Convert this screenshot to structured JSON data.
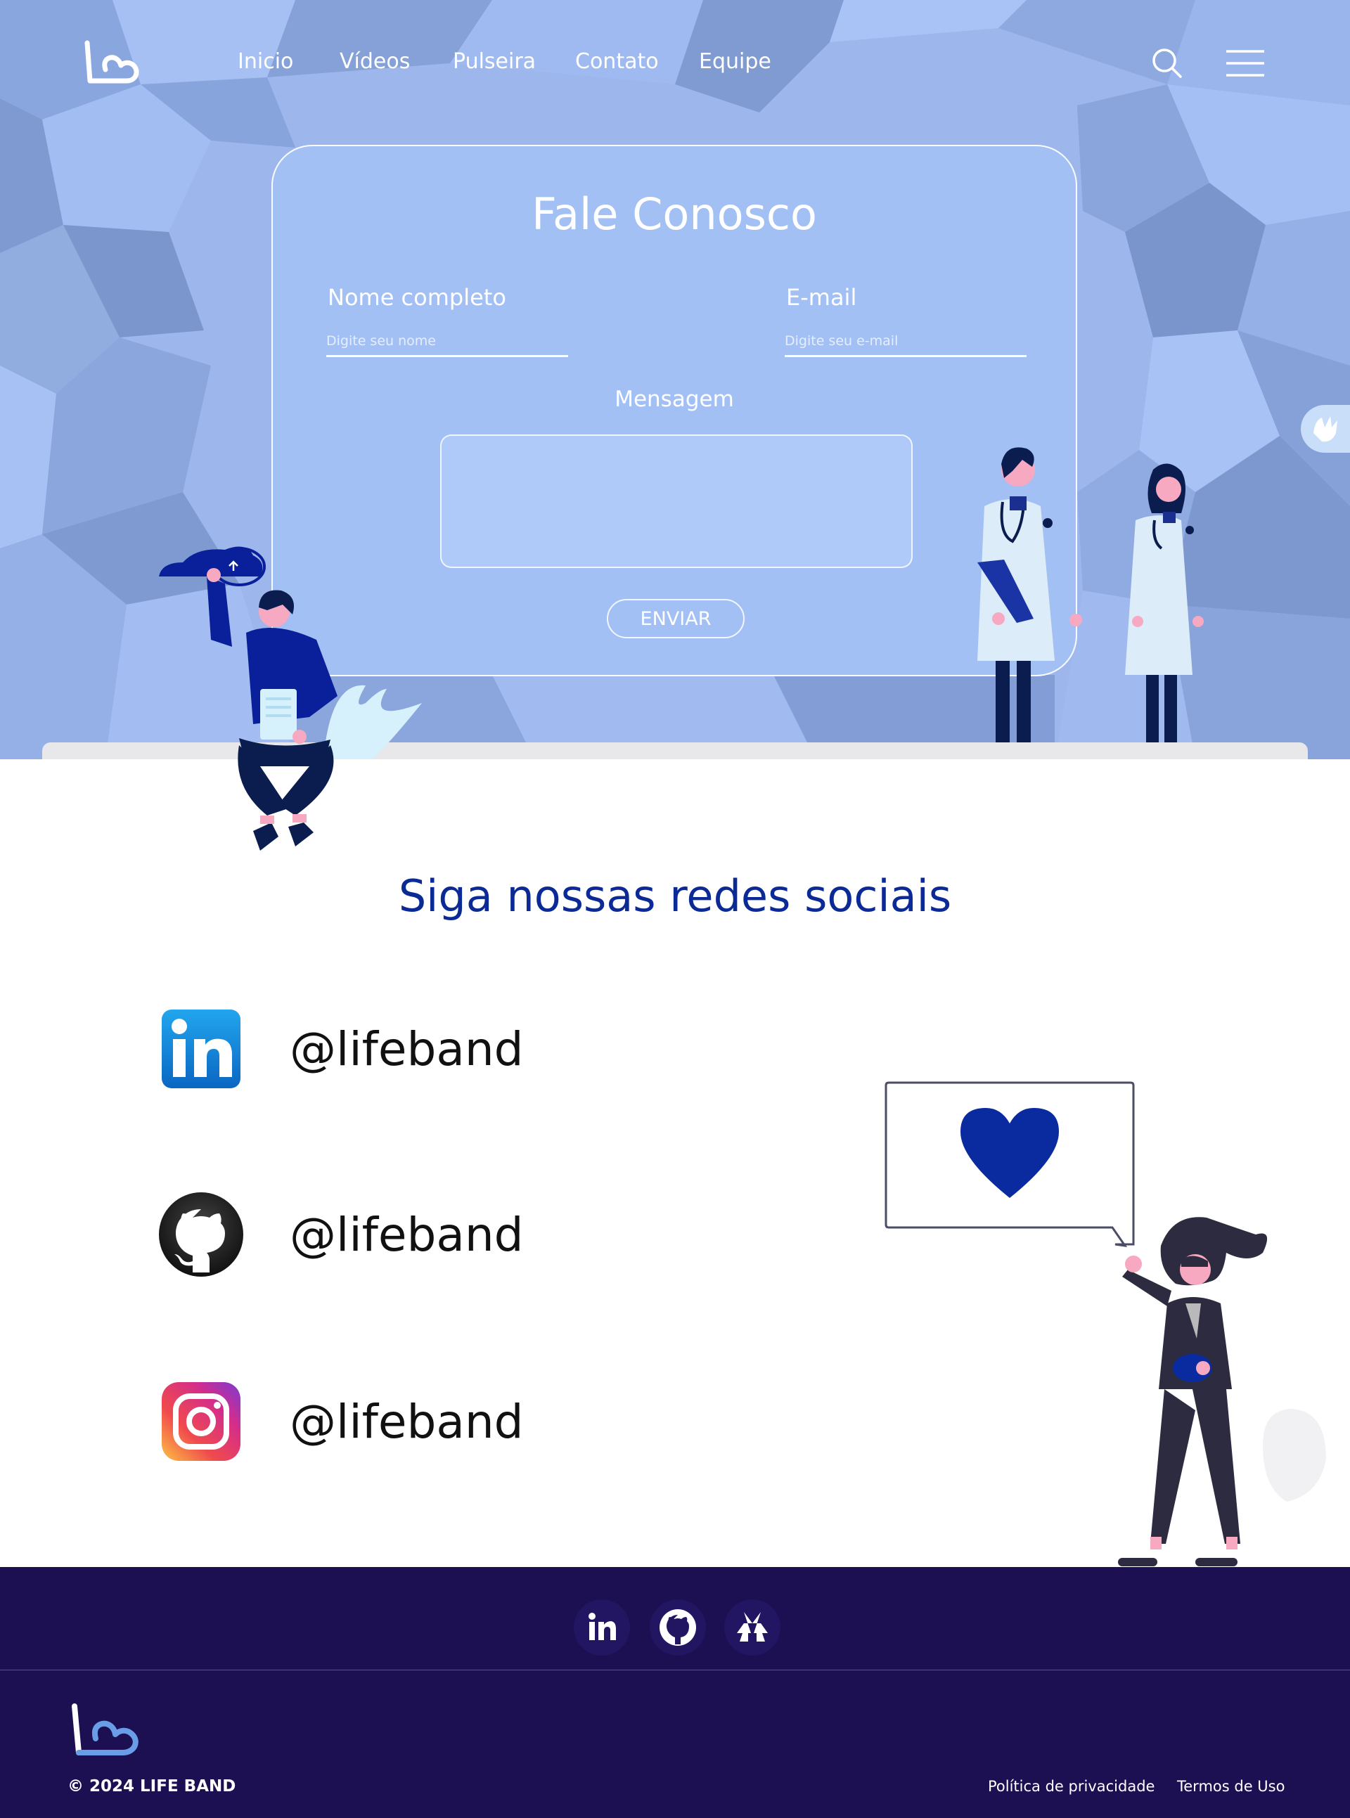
{
  "brand": {
    "name": "LIFE BAND"
  },
  "nav": {
    "items": [
      {
        "label": "Inicio"
      },
      {
        "label": "Vídeos"
      },
      {
        "label": "Pulseira"
      },
      {
        "label": "Contato"
      },
      {
        "label": "Equipe"
      }
    ]
  },
  "contact": {
    "title": "Fale Conosco",
    "name_label": "Nome completo",
    "name_placeholder": "Digite seu nome",
    "email_label": "E-mail",
    "email_placeholder": "Digite seu e-mail",
    "message_label": "Mensagem",
    "submit_label": "ENVIAR"
  },
  "social": {
    "title": "Siga nossas redes sociais",
    "items": [
      {
        "network": "linkedin",
        "icon": "linkedin-icon",
        "handle": "@lifeband"
      },
      {
        "network": "github",
        "icon": "github-icon",
        "handle": "@lifeband"
      },
      {
        "network": "instagram",
        "icon": "instagram-icon",
        "handle": "@lifeband"
      }
    ]
  },
  "footer": {
    "icons": [
      "linkedin-icon",
      "github-icon",
      "linktree-icon"
    ],
    "copyright": "© 2024 LIFE BAND",
    "links": [
      {
        "label": "Política de privacidade"
      },
      {
        "label": "Termos de Uso"
      }
    ]
  },
  "colors": {
    "hero_bg": "#9db7ee",
    "accent": "#0c2a96",
    "footer_bg": "#1c1052"
  }
}
